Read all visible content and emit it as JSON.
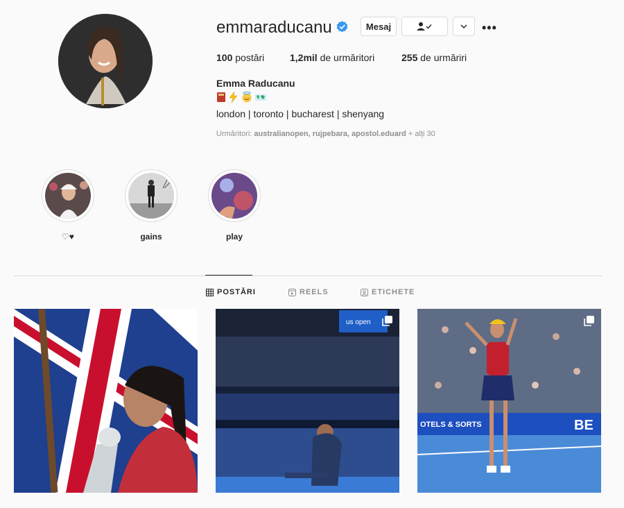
{
  "profile": {
    "username": "emmaraducanu",
    "full_name": "Emma Raducanu",
    "bio_emojis": "📕⚡😇🗺",
    "bio_line": "london | toronto | bucharest | shenyang",
    "buttons": {
      "message": "Mesaj",
      "follow_icon": "person-check-icon",
      "more_icon": "chevron-down-icon",
      "options": "•••"
    },
    "stats": {
      "posts_value": "100",
      "posts_label": "postări",
      "followers_value": "1,2mil",
      "followers_label": "de urmăritori",
      "following_value": "255",
      "following_label": "de urmăriri"
    },
    "followed_by": {
      "label": "Urmăritori:",
      "names": "australianopen, rujpebara, apostol.eduard",
      "more": "+ alți 30"
    },
    "verified_color": "#3897f0"
  },
  "highlights": [
    {
      "label": "♡♥"
    },
    {
      "label": "gains"
    },
    {
      "label": "play"
    }
  ],
  "tabs": [
    {
      "label": "POSTĂRI",
      "icon": "grid-icon",
      "active": true
    },
    {
      "label": "REELS",
      "icon": "reels-icon",
      "active": false
    },
    {
      "label": "ETICHETE",
      "icon": "tagged-icon",
      "active": false
    }
  ],
  "posts": [
    {
      "icon": "multiple-posts-icon"
    },
    {
      "icon": "multiple-posts-icon",
      "sign": "us open"
    },
    {
      "icon": "multiple-posts-icon",
      "sign": "OTELS & SORTS",
      "sign2": "BE"
    }
  ]
}
